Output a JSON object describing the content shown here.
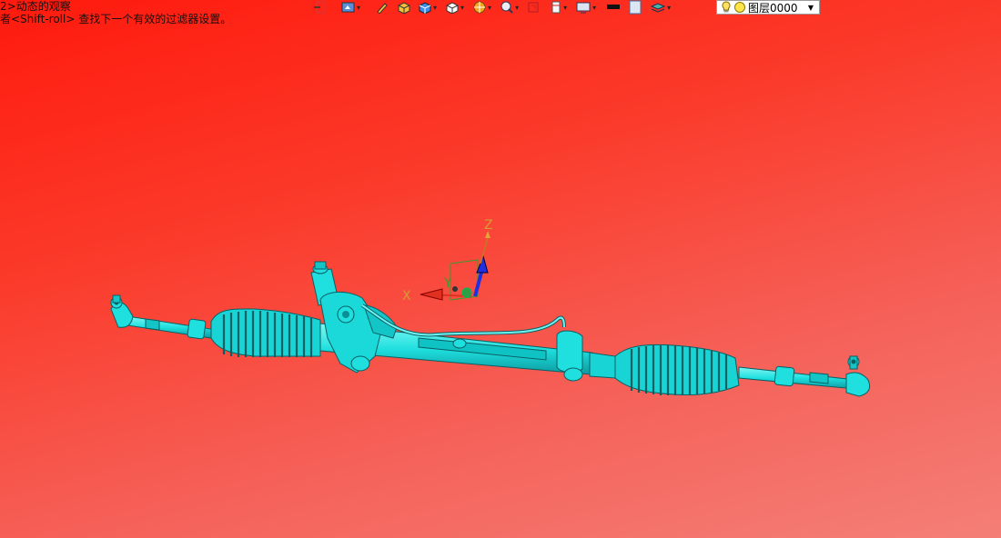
{
  "prompt": {
    "line1": "2>动态的观察",
    "line2": "者<Shift-roll> 查找下一个有效的过滤器设置。"
  },
  "toolbar": {
    "icons": [
      "snap-icon",
      "view-display-icon",
      "pencil-icon",
      "box-icon",
      "cube-shaded-icon",
      "cube-white-icon",
      "render-icon",
      "zoom-icon",
      "clip-icon",
      "section-icon",
      "display-settings-icon",
      "color-black-icon",
      "color-white-icon",
      "layer-stack-icon"
    ],
    "layer_value": "图层0000"
  },
  "viewport": {
    "axis_x": "X",
    "axis_y": "Y",
    "axis_z": "Z",
    "background_top": "#ff1a0d",
    "background_bottom": "#f47f77",
    "model_color": "#1fe0df",
    "model_shadow": "#0a8f95"
  }
}
